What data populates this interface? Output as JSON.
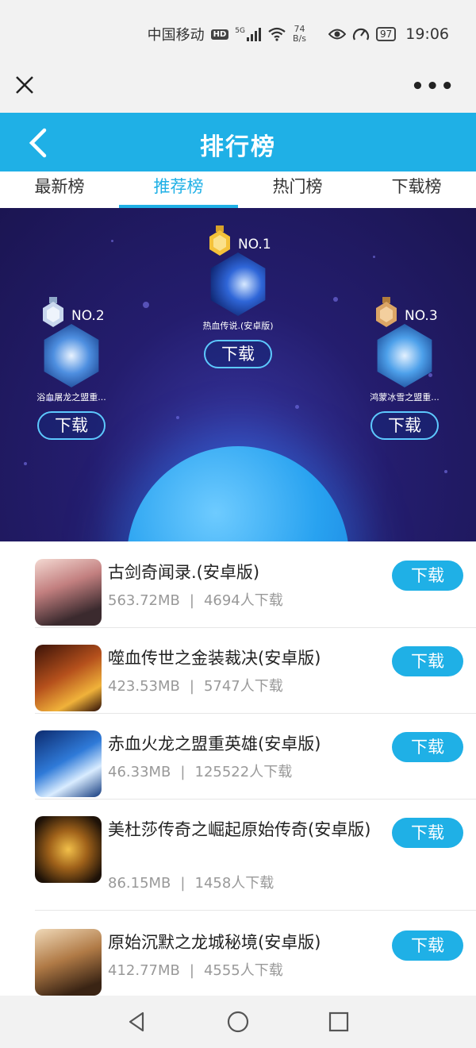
{
  "status_bar": {
    "carrier": "中国移动",
    "hd": "HD",
    "signal_type": "5G",
    "speed_value": "74",
    "speed_unit": "B/s",
    "battery": "97",
    "time": "19:06"
  },
  "header": {
    "title": "排行榜"
  },
  "tabs": [
    {
      "label": "最新榜",
      "active": false
    },
    {
      "label": "推荐榜",
      "active": true
    },
    {
      "label": "热门榜",
      "active": false
    },
    {
      "label": "下载榜",
      "active": false
    }
  ],
  "podium": [
    {
      "rank": "NO.1",
      "name": "热血传说.(安卓版)",
      "download": "下载",
      "medal": "gold-medal-icon"
    },
    {
      "rank": "NO.2",
      "name": "浴血屠龙之盟重...",
      "download": "下载",
      "medal": "silver-medal-icon"
    },
    {
      "rank": "NO.3",
      "name": "鸿蒙冰雪之盟重...",
      "download": "下载",
      "medal": "bronze-medal-icon"
    }
  ],
  "list": [
    {
      "title": "古剑奇闻录.(安卓版)",
      "size": "563.72MB",
      "sep": "|",
      "downloads": "4694人下载",
      "button": "下载"
    },
    {
      "title": "噬血传世之金装裁决(安卓版)",
      "size": "423.53MB",
      "sep": "|",
      "downloads": "5747人下载",
      "button": "下载"
    },
    {
      "title": "赤血火龙之盟重英雄(安卓版)",
      "size": "46.33MB",
      "sep": "|",
      "downloads": "125522人下载",
      "button": "下载"
    },
    {
      "title": "美杜莎传奇之崛起原始传奇(安卓版)",
      "size": "86.15MB",
      "sep": "|",
      "downloads": "1458人下载",
      "button": "下载"
    },
    {
      "title": "原始沉默之龙城秘境(安卓版)",
      "size": "412.77MB",
      "sep": "|",
      "downloads": "4555人下载",
      "button": "下载"
    }
  ],
  "colors": {
    "accent": "#1fb0e6",
    "banner_bg": "#1b1552"
  }
}
